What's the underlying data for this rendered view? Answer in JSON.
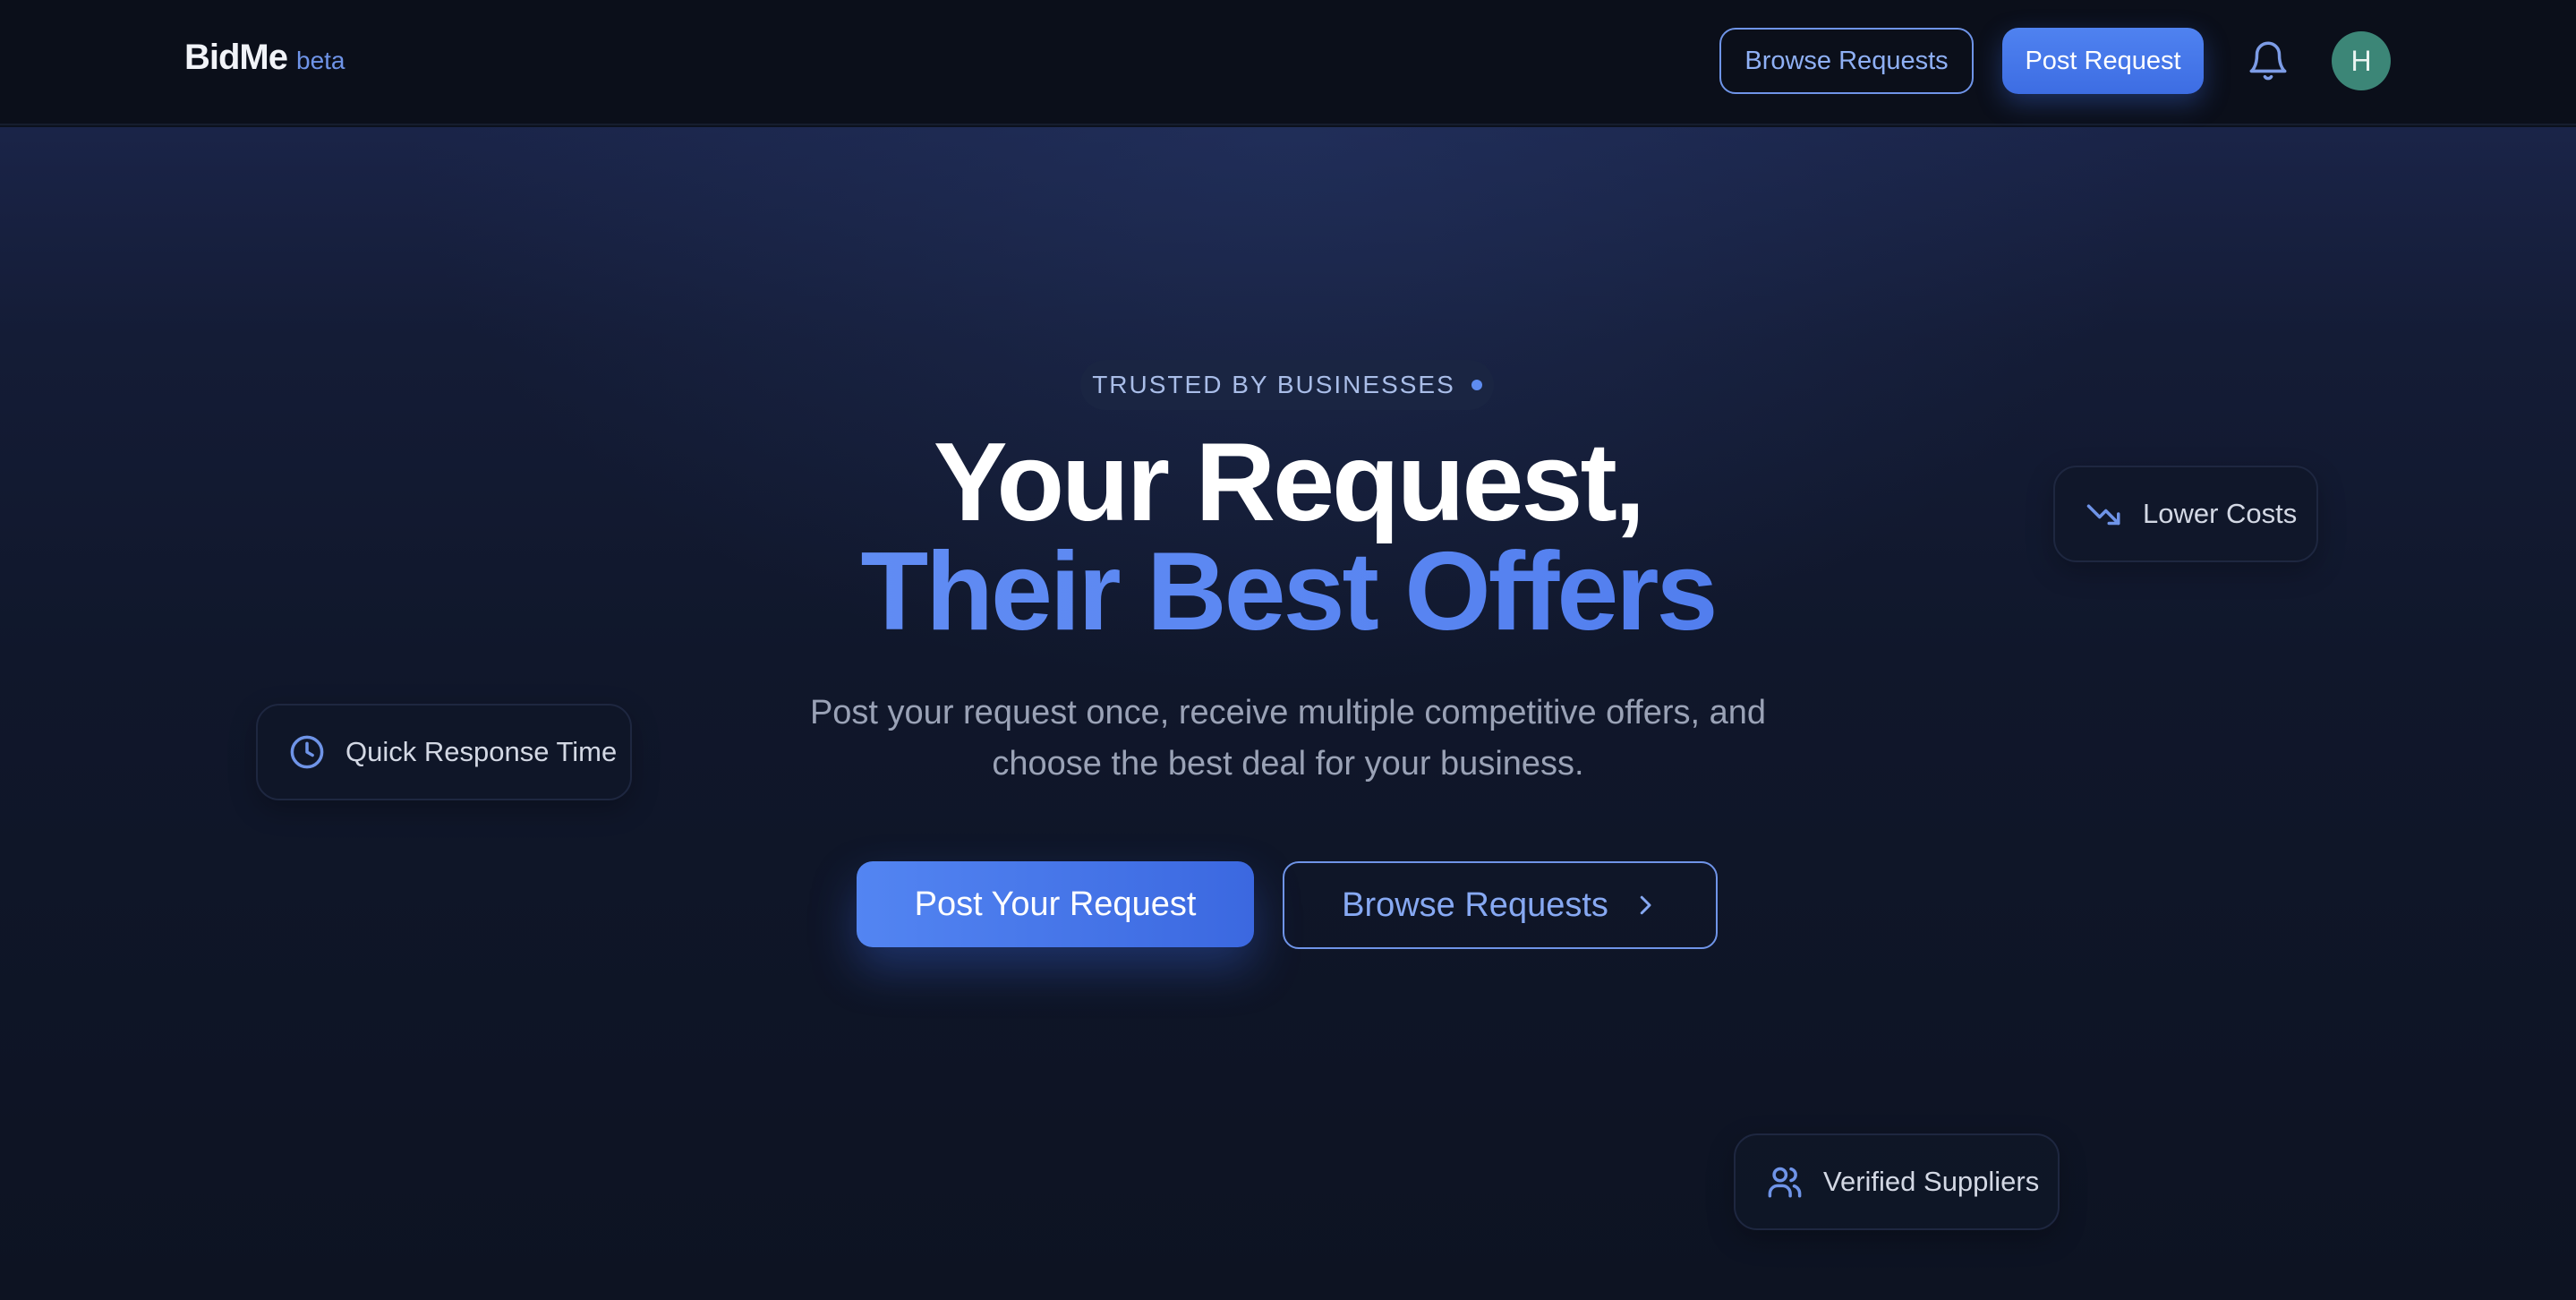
{
  "brand": {
    "name": "BidMe",
    "tag": "beta"
  },
  "nav": {
    "browse_label": "Browse Requests",
    "post_label": "Post Request",
    "bell_icon": "bell-icon",
    "avatar_initial": "H"
  },
  "hero": {
    "badge": "TRUSTED BY BUSINESSES",
    "headline_line1": "Your Request,",
    "headline_line2": "Their Best Offers",
    "subtitle": "Post your request once, receive multiple competitive offers, and choose the best deal for your business.",
    "cta_primary": "Post Your Request",
    "cta_secondary": "Browse Requests"
  },
  "chips": {
    "lower_costs": {
      "label": "Lower Costs",
      "icon": "trending-down-icon"
    },
    "quick_response": {
      "label": "Quick Response Time",
      "icon": "clock-icon"
    },
    "verified": {
      "label": "Verified Suppliers",
      "icon": "users-icon"
    }
  },
  "colors": {
    "accent": "#4f82f0",
    "accent_light": "#6f94e8",
    "avatar_bg": "#3c8677",
    "background": "#0c111d"
  }
}
